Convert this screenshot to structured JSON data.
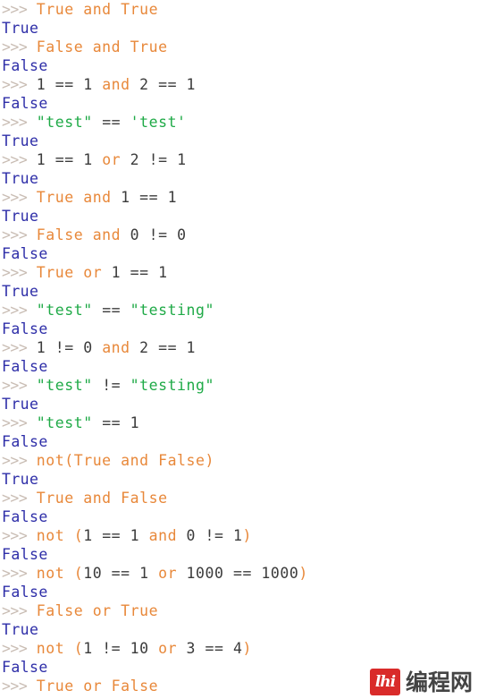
{
  "terminal": {
    "prompt": ">>>",
    "lines": [
      {
        "type": "input",
        "tokens": [
          {
            "t": "kw",
            "v": "True"
          },
          {
            "t": "plain",
            "v": " "
          },
          {
            "t": "kw",
            "v": "and"
          },
          {
            "t": "plain",
            "v": " "
          },
          {
            "t": "kw",
            "v": "True"
          }
        ],
        "text": "True and True"
      },
      {
        "type": "output",
        "text": "True"
      },
      {
        "type": "input",
        "tokens": [
          {
            "t": "kw",
            "v": "False"
          },
          {
            "t": "plain",
            "v": " "
          },
          {
            "t": "kw",
            "v": "and"
          },
          {
            "t": "plain",
            "v": " "
          },
          {
            "t": "kw",
            "v": "True"
          }
        ],
        "text": "False and True"
      },
      {
        "type": "output",
        "text": "False"
      },
      {
        "type": "input",
        "tokens": [
          {
            "t": "num",
            "v": "1"
          },
          {
            "t": "plain",
            "v": " "
          },
          {
            "t": "op",
            "v": "=="
          },
          {
            "t": "plain",
            "v": " "
          },
          {
            "t": "num",
            "v": "1"
          },
          {
            "t": "plain",
            "v": " "
          },
          {
            "t": "kw",
            "v": "and"
          },
          {
            "t": "plain",
            "v": " "
          },
          {
            "t": "num",
            "v": "2"
          },
          {
            "t": "plain",
            "v": " "
          },
          {
            "t": "op",
            "v": "=="
          },
          {
            "t": "plain",
            "v": " "
          },
          {
            "t": "num",
            "v": "1"
          }
        ],
        "text": "1 == 1 and 2 == 1"
      },
      {
        "type": "output",
        "text": "False"
      },
      {
        "type": "input",
        "tokens": [
          {
            "t": "str",
            "v": "\"test\""
          },
          {
            "t": "plain",
            "v": " "
          },
          {
            "t": "op",
            "v": "=="
          },
          {
            "t": "plain",
            "v": " "
          },
          {
            "t": "str",
            "v": "'test'"
          }
        ],
        "text": "\"test\" == 'test'"
      },
      {
        "type": "output",
        "text": "True"
      },
      {
        "type": "input",
        "tokens": [
          {
            "t": "num",
            "v": "1"
          },
          {
            "t": "plain",
            "v": " "
          },
          {
            "t": "op",
            "v": "=="
          },
          {
            "t": "plain",
            "v": " "
          },
          {
            "t": "num",
            "v": "1"
          },
          {
            "t": "plain",
            "v": " "
          },
          {
            "t": "kw",
            "v": "or"
          },
          {
            "t": "plain",
            "v": " "
          },
          {
            "t": "num",
            "v": "2"
          },
          {
            "t": "plain",
            "v": " "
          },
          {
            "t": "op",
            "v": "!="
          },
          {
            "t": "plain",
            "v": " "
          },
          {
            "t": "num",
            "v": "1"
          }
        ],
        "text": "1 == 1 or 2 != 1"
      },
      {
        "type": "output",
        "text": "True"
      },
      {
        "type": "input",
        "tokens": [
          {
            "t": "kw",
            "v": "True"
          },
          {
            "t": "plain",
            "v": " "
          },
          {
            "t": "kw",
            "v": "and"
          },
          {
            "t": "plain",
            "v": " "
          },
          {
            "t": "num",
            "v": "1"
          },
          {
            "t": "plain",
            "v": " "
          },
          {
            "t": "op",
            "v": "=="
          },
          {
            "t": "plain",
            "v": " "
          },
          {
            "t": "num",
            "v": "1"
          }
        ],
        "text": "True and 1 == 1"
      },
      {
        "type": "output",
        "text": "True"
      },
      {
        "type": "input",
        "tokens": [
          {
            "t": "kw",
            "v": "False"
          },
          {
            "t": "plain",
            "v": " "
          },
          {
            "t": "kw",
            "v": "and"
          },
          {
            "t": "plain",
            "v": " "
          },
          {
            "t": "num",
            "v": "0"
          },
          {
            "t": "plain",
            "v": " "
          },
          {
            "t": "op",
            "v": "!="
          },
          {
            "t": "plain",
            "v": " "
          },
          {
            "t": "num",
            "v": "0"
          }
        ],
        "text": "False and 0 != 0"
      },
      {
        "type": "output",
        "text": "False"
      },
      {
        "type": "input",
        "tokens": [
          {
            "t": "kw",
            "v": "True"
          },
          {
            "t": "plain",
            "v": " "
          },
          {
            "t": "kw",
            "v": "or"
          },
          {
            "t": "plain",
            "v": " "
          },
          {
            "t": "num",
            "v": "1"
          },
          {
            "t": "plain",
            "v": " "
          },
          {
            "t": "op",
            "v": "=="
          },
          {
            "t": "plain",
            "v": " "
          },
          {
            "t": "num",
            "v": "1"
          }
        ],
        "text": "True or 1 == 1"
      },
      {
        "type": "output",
        "text": "True"
      },
      {
        "type": "input",
        "tokens": [
          {
            "t": "str",
            "v": "\"test\""
          },
          {
            "t": "plain",
            "v": " "
          },
          {
            "t": "op",
            "v": "=="
          },
          {
            "t": "plain",
            "v": " "
          },
          {
            "t": "str",
            "v": "\"testing\""
          }
        ],
        "text": "\"test\" == \"testing\""
      },
      {
        "type": "output",
        "text": "False"
      },
      {
        "type": "input",
        "tokens": [
          {
            "t": "num",
            "v": "1"
          },
          {
            "t": "plain",
            "v": " "
          },
          {
            "t": "op",
            "v": "!="
          },
          {
            "t": "plain",
            "v": " "
          },
          {
            "t": "num",
            "v": "0"
          },
          {
            "t": "plain",
            "v": " "
          },
          {
            "t": "kw",
            "v": "and"
          },
          {
            "t": "plain",
            "v": " "
          },
          {
            "t": "num",
            "v": "2"
          },
          {
            "t": "plain",
            "v": " "
          },
          {
            "t": "op",
            "v": "=="
          },
          {
            "t": "plain",
            "v": " "
          },
          {
            "t": "num",
            "v": "1"
          }
        ],
        "text": "1 != 0 and 2 == 1"
      },
      {
        "type": "output",
        "text": "False"
      },
      {
        "type": "input",
        "tokens": [
          {
            "t": "str",
            "v": "\"test\""
          },
          {
            "t": "plain",
            "v": " "
          },
          {
            "t": "op",
            "v": "!="
          },
          {
            "t": "plain",
            "v": " "
          },
          {
            "t": "str",
            "v": "\"testing\""
          }
        ],
        "text": "\"test\" != \"testing\""
      },
      {
        "type": "output",
        "text": "True"
      },
      {
        "type": "input",
        "tokens": [
          {
            "t": "str",
            "v": "\"test\""
          },
          {
            "t": "plain",
            "v": " "
          },
          {
            "t": "op",
            "v": "=="
          },
          {
            "t": "plain",
            "v": " "
          },
          {
            "t": "num",
            "v": "1"
          }
        ],
        "text": "\"test\" == 1"
      },
      {
        "type": "output",
        "text": "False"
      },
      {
        "type": "input",
        "tokens": [
          {
            "t": "kw",
            "v": "not"
          },
          {
            "t": "punct",
            "v": "("
          },
          {
            "t": "kw",
            "v": "True"
          },
          {
            "t": "plain",
            "v": " "
          },
          {
            "t": "kw",
            "v": "and"
          },
          {
            "t": "plain",
            "v": " "
          },
          {
            "t": "kw",
            "v": "False"
          },
          {
            "t": "punct",
            "v": ")"
          }
        ],
        "text": "not(True and False)"
      },
      {
        "type": "output",
        "text": "True"
      },
      {
        "type": "input",
        "tokens": [
          {
            "t": "kw",
            "v": "True"
          },
          {
            "t": "plain",
            "v": " "
          },
          {
            "t": "kw",
            "v": "and"
          },
          {
            "t": "plain",
            "v": " "
          },
          {
            "t": "kw",
            "v": "False"
          }
        ],
        "text": "True and False"
      },
      {
        "type": "output",
        "text": "False"
      },
      {
        "type": "input",
        "tokens": [
          {
            "t": "kw",
            "v": "not"
          },
          {
            "t": "plain",
            "v": " "
          },
          {
            "t": "punct",
            "v": "("
          },
          {
            "t": "num",
            "v": "1"
          },
          {
            "t": "plain",
            "v": " "
          },
          {
            "t": "op",
            "v": "=="
          },
          {
            "t": "plain",
            "v": " "
          },
          {
            "t": "num",
            "v": "1"
          },
          {
            "t": "plain",
            "v": " "
          },
          {
            "t": "kw",
            "v": "and"
          },
          {
            "t": "plain",
            "v": " "
          },
          {
            "t": "num",
            "v": "0"
          },
          {
            "t": "plain",
            "v": " "
          },
          {
            "t": "op",
            "v": "!="
          },
          {
            "t": "plain",
            "v": " "
          },
          {
            "t": "num",
            "v": "1"
          },
          {
            "t": "punct",
            "v": ")"
          }
        ],
        "text": "not (1 == 1 and 0 != 1)"
      },
      {
        "type": "output",
        "text": "False"
      },
      {
        "type": "input",
        "tokens": [
          {
            "t": "kw",
            "v": "not"
          },
          {
            "t": "plain",
            "v": " "
          },
          {
            "t": "punct",
            "v": "("
          },
          {
            "t": "num",
            "v": "10"
          },
          {
            "t": "plain",
            "v": " "
          },
          {
            "t": "op",
            "v": "=="
          },
          {
            "t": "plain",
            "v": " "
          },
          {
            "t": "num",
            "v": "1"
          },
          {
            "t": "plain",
            "v": " "
          },
          {
            "t": "kw",
            "v": "or"
          },
          {
            "t": "plain",
            "v": " "
          },
          {
            "t": "num",
            "v": "1000"
          },
          {
            "t": "plain",
            "v": " "
          },
          {
            "t": "op",
            "v": "=="
          },
          {
            "t": "plain",
            "v": " "
          },
          {
            "t": "num",
            "v": "1000"
          },
          {
            "t": "punct",
            "v": ")"
          }
        ],
        "text": "not (10 == 1 or 1000 == 1000)"
      },
      {
        "type": "output",
        "text": "False"
      },
      {
        "type": "input",
        "tokens": [
          {
            "t": "kw",
            "v": "False"
          },
          {
            "t": "plain",
            "v": " "
          },
          {
            "t": "kw",
            "v": "or"
          },
          {
            "t": "plain",
            "v": " "
          },
          {
            "t": "kw",
            "v": "True"
          }
        ],
        "text": "False or True"
      },
      {
        "type": "output",
        "text": "True"
      },
      {
        "type": "input",
        "tokens": [
          {
            "t": "kw",
            "v": "not"
          },
          {
            "t": "plain",
            "v": " "
          },
          {
            "t": "punct",
            "v": "("
          },
          {
            "t": "num",
            "v": "1"
          },
          {
            "t": "plain",
            "v": " "
          },
          {
            "t": "op",
            "v": "!="
          },
          {
            "t": "plain",
            "v": " "
          },
          {
            "t": "num",
            "v": "10"
          },
          {
            "t": "plain",
            "v": " "
          },
          {
            "t": "kw",
            "v": "or"
          },
          {
            "t": "plain",
            "v": " "
          },
          {
            "t": "num",
            "v": "3"
          },
          {
            "t": "plain",
            "v": " "
          },
          {
            "t": "op",
            "v": "=="
          },
          {
            "t": "plain",
            "v": " "
          },
          {
            "t": "num",
            "v": "4"
          },
          {
            "t": "punct",
            "v": ")"
          }
        ],
        "text": "not (1 != 10 or 3 == 4)"
      },
      {
        "type": "output",
        "text": "False"
      },
      {
        "type": "input",
        "tokens": [
          {
            "t": "kw",
            "v": "True"
          },
          {
            "t": "plain",
            "v": " "
          },
          {
            "t": "kw",
            "v": "or"
          },
          {
            "t": "plain",
            "v": " "
          },
          {
            "t": "kw",
            "v": "False"
          }
        ],
        "text": "True or False"
      }
    ]
  },
  "watermark": {
    "badge_text": "lhi",
    "text": "编程网"
  },
  "colors": {
    "keyword": "#e8883a",
    "string": "#1faa47",
    "output": "#2e2ea8",
    "plain": "#3b3b3b",
    "prompt": "#c9bdb4",
    "background": "#ffffff",
    "watermark_badge": "#d8201f",
    "watermark_text": "#3a3a3a"
  }
}
